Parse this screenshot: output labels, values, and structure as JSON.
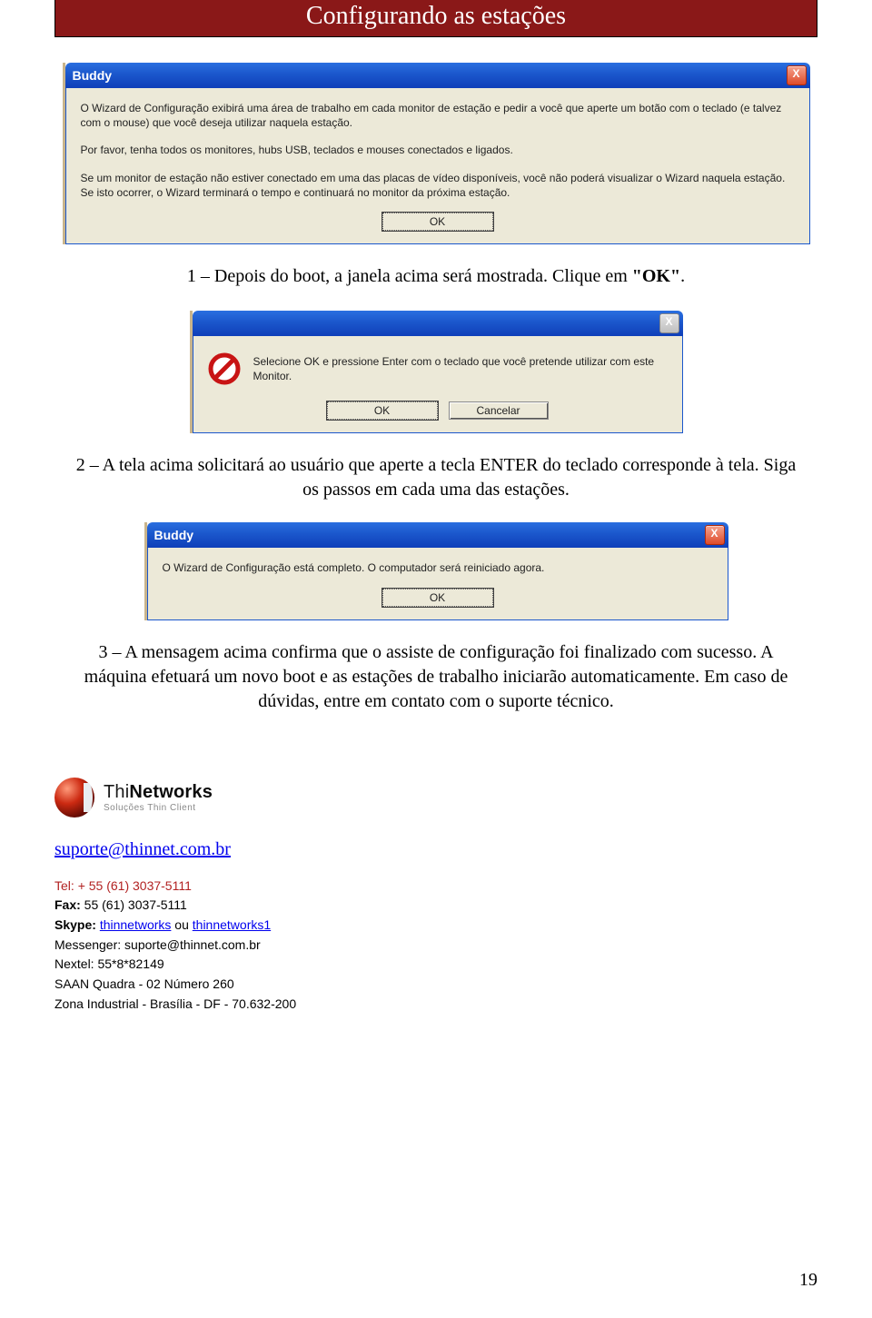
{
  "header": {
    "title": "Configurando as estações"
  },
  "dialog1": {
    "title": "Buddy",
    "close_label": "X",
    "p1": "O Wizard de Configuração exibirá uma área de trabalho em cada monitor de estação e pedir a você que aperte um botão com o teclado (e talvez com o mouse) que você deseja utilizar naquela estação.",
    "p2": "Por favor, tenha todos os monitores, hubs USB, teclados e mouses conectados e ligados.",
    "p3": "Se um monitor de estação não estiver conectado em uma das placas de vídeo disponíveis, você não poderá visualizar o Wizard naquela estação. Se isto ocorrer, o Wizard terminará o tempo e continuará no monitor da próxima estação.",
    "ok": "OK"
  },
  "step1": {
    "prefix": "1 – Depois do boot, a janela acima será mostrada. Clique em ",
    "bold": "\"OK\"",
    "suffix": "."
  },
  "dialog2": {
    "close_label": "X",
    "body": "Selecione OK e pressione Enter com o teclado que você pretende utilizar com este Monitor.",
    "ok": "OK",
    "cancel": "Cancelar"
  },
  "step2": "2 – A tela acima solicitará ao usuário que aperte a tecla ENTER do teclado corresponde à tela. Siga os passos em cada uma das estações.",
  "dialog3": {
    "title": "Buddy",
    "close_label": "X",
    "body": "O Wizard de Configuração está completo. O computador será reiniciado agora.",
    "ok": "OK"
  },
  "step3": "3 – A mensagem acima confirma que o assiste de configuração foi finalizado com sucesso. A máquina efetuará um novo boot e as estações de trabalho iniciarão automaticamente. Em caso de dúvidas, entre em contato com o suporte técnico.",
  "logo": {
    "thin": "Thi",
    "networks": "Networks",
    "tagline": "Soluções Thin Client"
  },
  "contact": {
    "email": "suporte@thinnet.com.br",
    "tel_label": "Tel: ",
    "tel_value": "+ 55 (61) 3037-5111",
    "fax_label": "Fax:",
    "fax_value": " 55 (61) 3037-5111",
    "skype_label": "Skype:",
    "skype_link1": "thinnetworks",
    "skype_sep": "  ou  ",
    "skype_link2": " thinnetworks1",
    "msn_label": "Messenger: ",
    "msn_value": "suporte@thinnet.com.br",
    "nextel_label": "Nextel: ",
    "nextel_value": "55*8*82149",
    "addr1": "SAAN Quadra -  02 Número 260",
    "addr2": "Zona Industrial - Brasília - DF  - 70.632-200"
  },
  "page_number": "19"
}
